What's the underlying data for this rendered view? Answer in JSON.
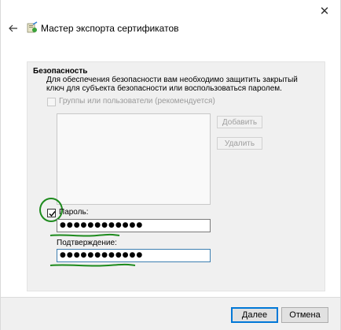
{
  "window": {
    "title": "Мастер экспорта сертификатов",
    "close_glyph": "✕",
    "back_icon": "back-arrow-icon",
    "wizard_icon": "certificate-wizard-icon"
  },
  "security": {
    "header": "Безопасность",
    "description": "Для обеспечения безопасности вам необходимо защитить закрытый ключ для субъекта безопасности или воспользоваться паролем.",
    "groups_checkbox_label": "Группы или пользователи (рекомендуется)",
    "groups_checked": false,
    "add_button": "Добавить",
    "remove_button": "Удалить",
    "password_checked": true,
    "password_label": "Пароль:",
    "password_value": "●●●●●●●●●●●●",
    "confirm_label": "Подтверждение:",
    "confirm_value": "●●●●●●●●●●●●"
  },
  "footer": {
    "next_button": "Далее",
    "cancel_button": "Отмена"
  },
  "colors": {
    "annotation": "#1d8a1d",
    "focus": "#0078d7"
  }
}
